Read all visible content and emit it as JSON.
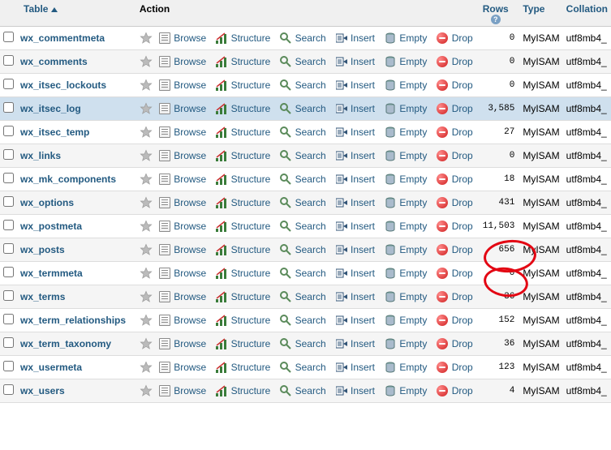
{
  "headers": {
    "table": "Table",
    "action": "Action",
    "rows": "Rows",
    "type": "Type",
    "collation": "Collation"
  },
  "actions": {
    "browse": "Browse",
    "structure": "Structure",
    "search": "Search",
    "insert": "Insert",
    "empty": "Empty",
    "drop": "Drop"
  },
  "tables": [
    {
      "name": "wx_commentmeta",
      "rows": "0",
      "type": "MyISAM",
      "collation": "utf8mb4_",
      "cls": "even"
    },
    {
      "name": "wx_comments",
      "rows": "0",
      "type": "MyISAM",
      "collation": "utf8mb4_",
      "cls": "odd"
    },
    {
      "name": "wx_itsec_lockouts",
      "rows": "0",
      "type": "MyISAM",
      "collation": "utf8mb4_",
      "cls": "even"
    },
    {
      "name": "wx_itsec_log",
      "rows": "3,585",
      "type": "MyISAM",
      "collation": "utf8mb4_",
      "cls": "selected"
    },
    {
      "name": "wx_itsec_temp",
      "rows": "27",
      "type": "MyISAM",
      "collation": "utf8mb4_",
      "cls": "even"
    },
    {
      "name": "wx_links",
      "rows": "0",
      "type": "MyISAM",
      "collation": "utf8mb4_",
      "cls": "odd"
    },
    {
      "name": "wx_mk_components",
      "rows": "18",
      "type": "MyISAM",
      "collation": "utf8mb4_",
      "cls": "even"
    },
    {
      "name": "wx_options",
      "rows": "431",
      "type": "MyISAM",
      "collation": "utf8mb4_",
      "cls": "odd"
    },
    {
      "name": "wx_postmeta",
      "rows": "11,503",
      "type": "MyISAM",
      "collation": "utf8mb4_",
      "cls": "even"
    },
    {
      "name": "wx_posts",
      "rows": "656",
      "type": "MyISAM",
      "collation": "utf8mb4_",
      "cls": "odd"
    },
    {
      "name": "wx_termmeta",
      "rows": "0",
      "type": "MyISAM",
      "collation": "utf8mb4_",
      "cls": "even"
    },
    {
      "name": "wx_terms",
      "rows": "36",
      "type": "MyISAM",
      "collation": "utf8mb4_",
      "cls": "odd"
    },
    {
      "name": "wx_term_relationships",
      "rows": "152",
      "type": "MyISAM",
      "collation": "utf8mb4_",
      "cls": "even"
    },
    {
      "name": "wx_term_taxonomy",
      "rows": "36",
      "type": "MyISAM",
      "collation": "utf8mb4_",
      "cls": "odd"
    },
    {
      "name": "wx_usermeta",
      "rows": "123",
      "type": "MyISAM",
      "collation": "utf8mb4_",
      "cls": "even"
    },
    {
      "name": "wx_users",
      "rows": "4",
      "type": "MyISAM",
      "collation": "utf8mb4_",
      "cls": "odd"
    }
  ]
}
